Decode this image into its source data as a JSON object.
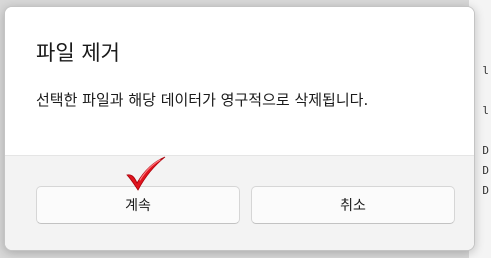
{
  "dialog": {
    "title": "파일 제거",
    "message": "선택한 파일과 해당 데이터가 영구적으로 삭제됩니다.",
    "continue_label": "계속",
    "cancel_label": "취소"
  },
  "background": {
    "glyphs": [
      "l",
      "l",
      "D",
      "D",
      "D"
    ]
  },
  "icons": {
    "annotation": "check-mark-icon"
  },
  "colors": {
    "annotation": "#e0141e",
    "dialog_bg": "#ffffff",
    "footer_bg": "#f3f3f3"
  }
}
